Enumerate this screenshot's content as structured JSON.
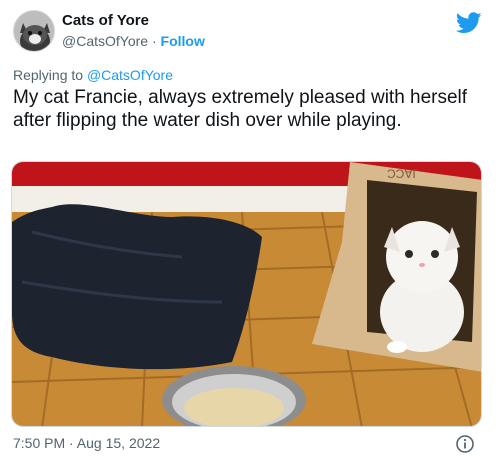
{
  "tweet": {
    "display_name": "Cats of Yore",
    "handle": "@CatsOfYore",
    "separator": " · ",
    "follow_label": "Follow",
    "replying_prefix": "Replying to ",
    "replying_to": "@CatsOfYore",
    "text": "My cat Francie, always extremely pleased with herself after flipping the water dish over while playing.",
    "timestamp": "7:50 PM · Aug 15, 2022"
  },
  "icons": {
    "platform": "twitter-bird-icon",
    "info": "info-icon"
  },
  "colors": {
    "accent": "#1d9bf0",
    "secondary_text": "#536471",
    "primary_text": "#0f1419"
  }
}
